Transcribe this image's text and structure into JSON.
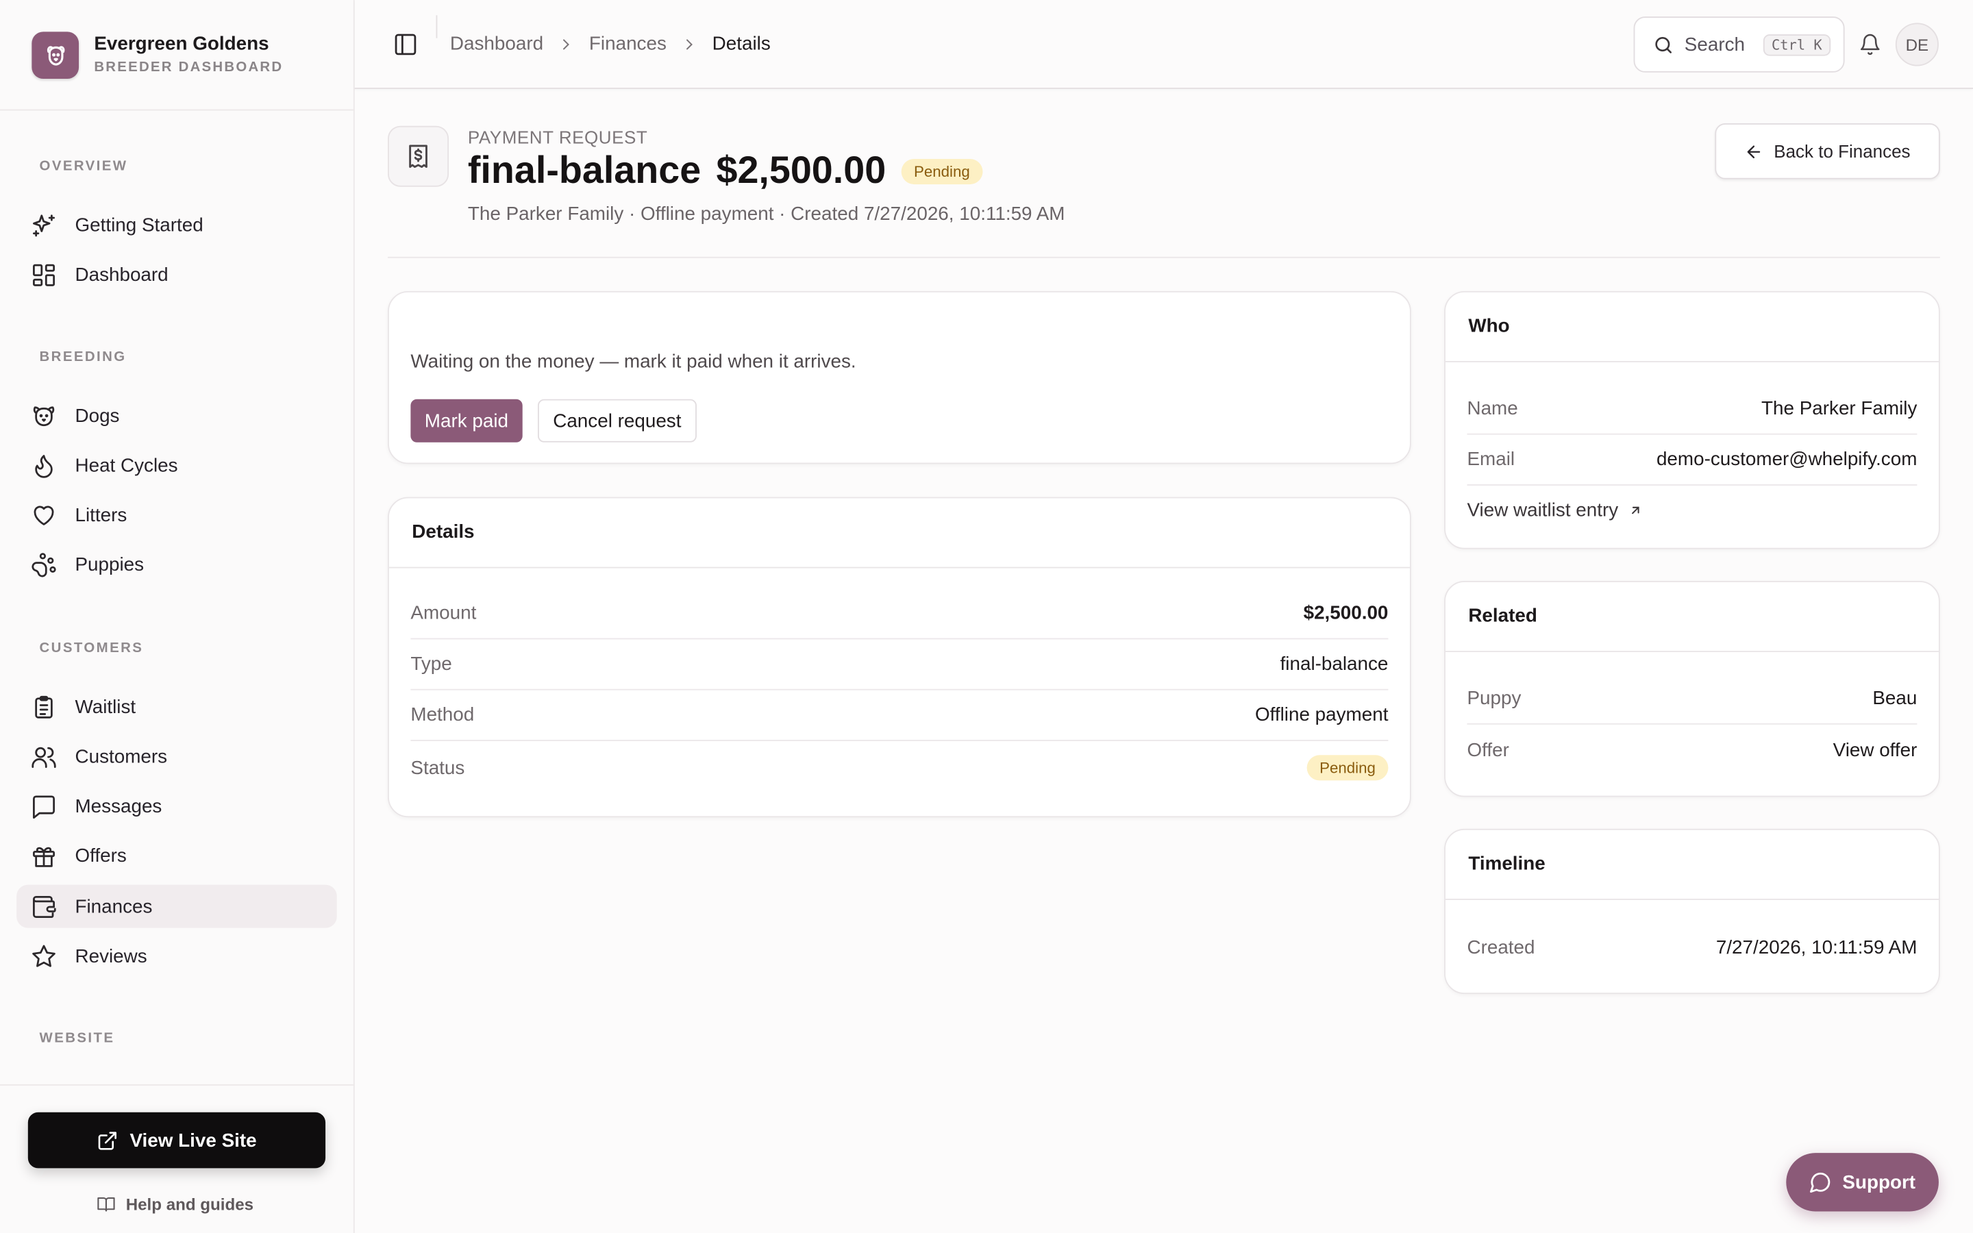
{
  "brand": {
    "name": "Evergreen Goldens",
    "subtitle": "BREEDER DASHBOARD"
  },
  "sidebar": {
    "sections": [
      {
        "label": "OVERVIEW",
        "items": [
          {
            "label": "Getting Started",
            "icon": "sparkles-icon"
          },
          {
            "label": "Dashboard",
            "icon": "grid-icon"
          }
        ]
      },
      {
        "label": "BREEDING",
        "items": [
          {
            "label": "Dogs",
            "icon": "dog-icon"
          },
          {
            "label": "Heat Cycles",
            "icon": "flame-icon"
          },
          {
            "label": "Litters",
            "icon": "heart-icon"
          },
          {
            "label": "Puppies",
            "icon": "paw-icon"
          }
        ]
      },
      {
        "label": "CUSTOMERS",
        "items": [
          {
            "label": "Waitlist",
            "icon": "clipboard-list-icon"
          },
          {
            "label": "Customers",
            "icon": "users-icon"
          },
          {
            "label": "Messages",
            "icon": "message-square-icon"
          },
          {
            "label": "Offers",
            "icon": "gift-icon"
          },
          {
            "label": "Finances",
            "icon": "wallet-icon",
            "active": true
          },
          {
            "label": "Reviews",
            "icon": "star-icon"
          }
        ]
      },
      {
        "label": "WEBSITE",
        "items": []
      }
    ],
    "view_live_site": "View Live Site",
    "help": "Help and guides"
  },
  "topbar": {
    "breadcrumb": [
      "Dashboard",
      "Finances",
      "Details"
    ],
    "search_placeholder": "Search",
    "search_shortcut": "Ctrl K",
    "avatar_initials": "DE"
  },
  "header": {
    "eyebrow": "PAYMENT REQUEST",
    "title": "final-balance",
    "amount": "$2,500.00",
    "status": "Pending",
    "subline": "The Parker Family · Offline payment · Created 7/27/2026, 10:11:59 AM",
    "back_label": "Back to Finances"
  },
  "action_card": {
    "message": "Waiting on the money — mark it paid when it arrives.",
    "mark_paid": "Mark paid",
    "cancel": "Cancel request"
  },
  "details_card": {
    "title": "Details",
    "rows": [
      {
        "key": "Amount",
        "value": "$2,500.00"
      },
      {
        "key": "Type",
        "value": "final-balance"
      },
      {
        "key": "Method",
        "value": "Offline payment"
      },
      {
        "key": "Status",
        "value": "Pending"
      }
    ]
  },
  "who_card": {
    "title": "Who",
    "rows": [
      {
        "key": "Name",
        "value": "The Parker Family"
      },
      {
        "key": "Email",
        "value": "demo-customer@whelpify.com"
      }
    ],
    "link": "View waitlist entry"
  },
  "related_card": {
    "title": "Related",
    "rows": [
      {
        "key": "Puppy",
        "value": "Beau"
      },
      {
        "key": "Offer",
        "value": "View offer"
      }
    ]
  },
  "timeline_card": {
    "title": "Timeline",
    "rows": [
      {
        "key": "Created",
        "value": "7/27/2026, 10:11:59 AM"
      }
    ]
  },
  "support": {
    "label": "Support"
  },
  "colors": {
    "accent": "#8b5a78",
    "pending_bg": "#fdf0c4",
    "pending_text": "#8a5c0e"
  }
}
